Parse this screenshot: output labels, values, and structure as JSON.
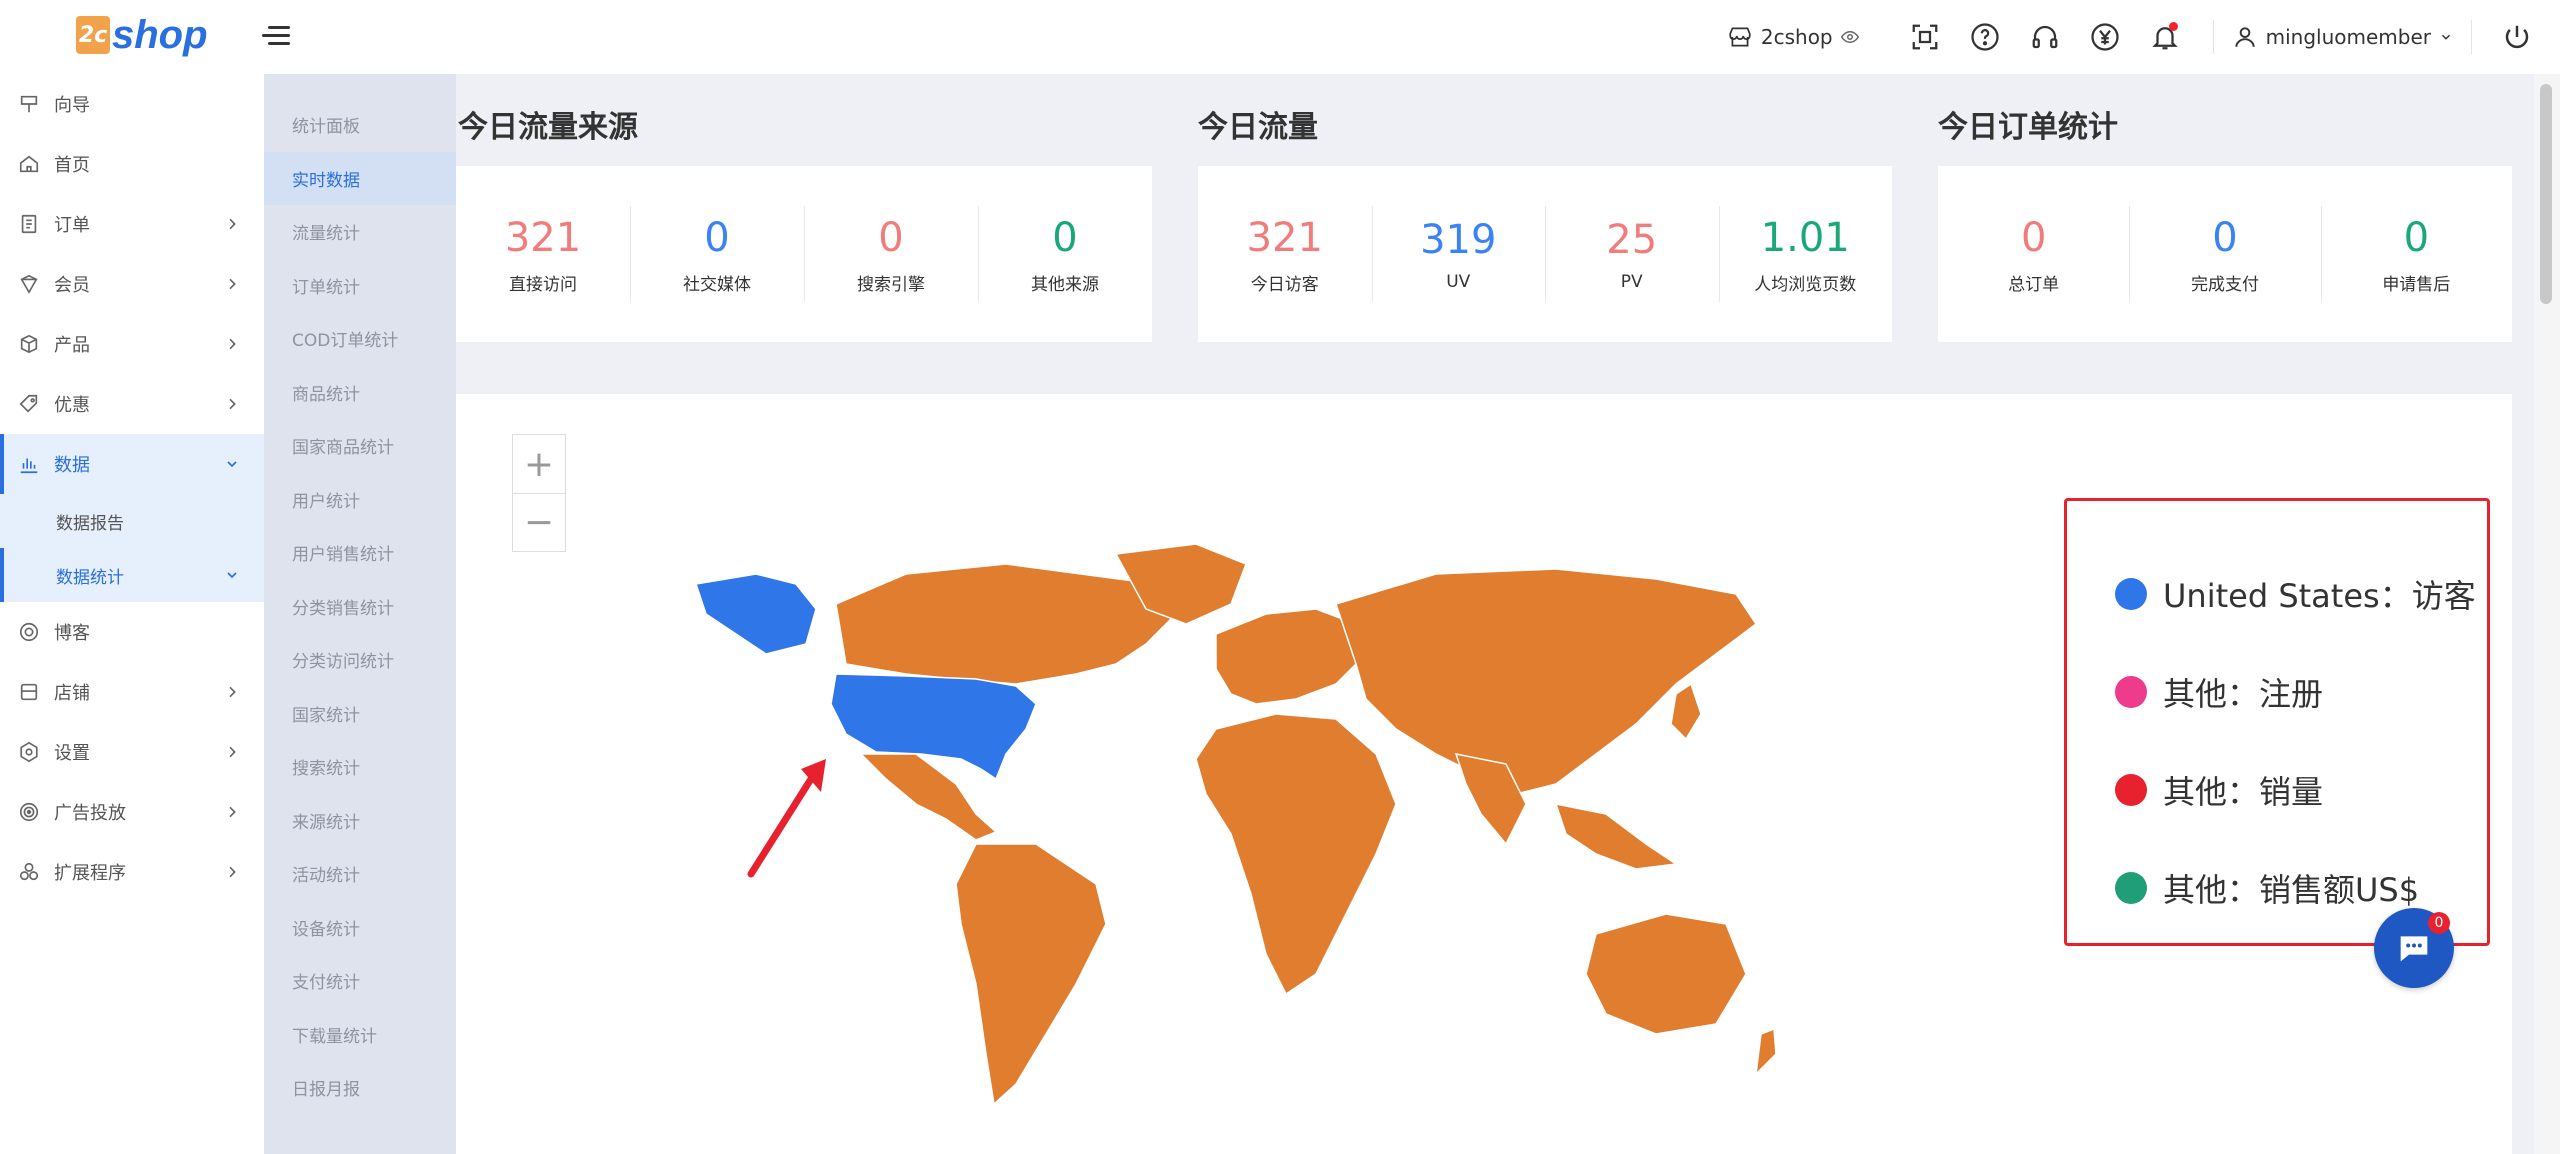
{
  "header": {
    "logo_badge": "2c",
    "logo_text": "shop",
    "shop_name": "2cshop",
    "username": "mingluomember"
  },
  "sidebar": {
    "items": [
      {
        "label": "向导",
        "icon": "guide-icon"
      },
      {
        "label": "首页",
        "icon": "home-icon"
      },
      {
        "label": "订单",
        "icon": "order-icon"
      },
      {
        "label": "会员",
        "icon": "member-icon"
      },
      {
        "label": "产品",
        "icon": "product-icon"
      },
      {
        "label": "优惠",
        "icon": "coupon-icon"
      },
      {
        "label": "数据",
        "icon": "chart-icon"
      },
      {
        "label": "博客",
        "icon": "blog-icon"
      },
      {
        "label": "店铺",
        "icon": "store-icon"
      },
      {
        "label": "设置",
        "icon": "settings-icon"
      },
      {
        "label": "广告投放",
        "icon": "ads-icon"
      },
      {
        "label": "扩展程序",
        "icon": "extension-icon"
      }
    ],
    "data_sub": [
      "数据报告",
      "数据统计"
    ]
  },
  "subnav": [
    "统计面板",
    "实时数据",
    "流量统计",
    "订单统计",
    "COD订单统计",
    "商品统计",
    "国家商品统计",
    "用户统计",
    "用户销售统计",
    "分类销售统计",
    "分类访问统计",
    "国家统计",
    "搜索统计",
    "来源统计",
    "活动统计",
    "设备统计",
    "支付统计",
    "下载量统计",
    "日报月报"
  ],
  "traffic_source": {
    "title": "今日流量来源",
    "stats": [
      {
        "value": "321",
        "label": "直接访问",
        "color": "#f07c7c"
      },
      {
        "value": "0",
        "label": "社交媒体",
        "color": "#3b82f6"
      },
      {
        "value": "0",
        "label": "搜索引擎",
        "color": "#f07c7c"
      },
      {
        "value": "0",
        "label": "其他来源",
        "color": "#1aa87a"
      }
    ]
  },
  "traffic_today": {
    "title": "今日流量",
    "stats": [
      {
        "value": "321",
        "label": "今日访客",
        "color": "#f07c7c"
      },
      {
        "value": "319",
        "label": "UV",
        "color": "#3b82f6"
      },
      {
        "value": "25",
        "label": "PV",
        "color": "#f07c7c"
      },
      {
        "value": "1.01",
        "label": "人均浏览页数",
        "color": "#1aa87a"
      }
    ]
  },
  "orders_today": {
    "title": "今日订单统计",
    "stats": [
      {
        "value": "0",
        "label": "总订单",
        "color": "#f07c7c"
      },
      {
        "value": "0",
        "label": "完成支付",
        "color": "#3b82f6"
      },
      {
        "value": "0",
        "label": "申请售后",
        "color": "#1aa87a"
      }
    ]
  },
  "map": {
    "zoom_in": "+",
    "zoom_out": "−",
    "highlight_color": "#2f76e8",
    "land_color": "#e07d2f",
    "legend": [
      {
        "label": "United States：访客",
        "color": "#2f76e8"
      },
      {
        "label": "其他：注册",
        "color": "#ef3b8b"
      },
      {
        "label": "其他：销量",
        "color": "#e8212e"
      },
      {
        "label": "其他：销售额US$",
        "color": "#1f9e78"
      }
    ]
  },
  "chat": {
    "badge": "0"
  }
}
